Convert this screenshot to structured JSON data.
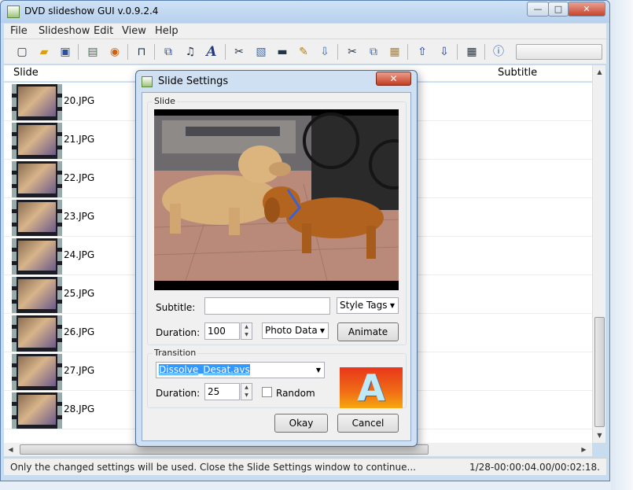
{
  "window": {
    "title": "DVD slideshow GUI v.0.9.2.4",
    "minimize": "—",
    "maximize": "□",
    "close": "✕"
  },
  "menu": [
    "File",
    "Slideshow",
    "Edit",
    "View",
    "Help"
  ],
  "toolbar_icons": [
    "new-icon",
    "open-icon",
    "save-icon",
    "add-slides-icon",
    "add-dvd-icon",
    "preview-icon",
    "copy-slide-icon",
    "music-icon",
    "title-icon",
    "cut-icon",
    "image-edit-icon",
    "clapper-icon",
    "pencil-icon",
    "burn-icon",
    "scissors-icon",
    "copy-icon",
    "paste-icon",
    "move-up-icon",
    "move-down-icon",
    "grid-icon",
    "help-icon"
  ],
  "list": {
    "headers": {
      "slide": "Slide",
      "subtitle": "Subtitle"
    },
    "rows": [
      "20.JPG",
      "21.JPG",
      "22.JPG",
      "23.JPG",
      "24.JPG",
      "25.JPG",
      "26.JPG",
      "27.JPG",
      "28.JPG"
    ]
  },
  "status": {
    "text": "Only the changed settings will be used. Close the Slide Settings window to continue...",
    "time": "1/28-00:00:04.00/00:02:18."
  },
  "dialog": {
    "title": "Slide Settings",
    "close": "✕",
    "slide_group": "Slide",
    "subtitle_label": "Subtitle:",
    "subtitle_value": "",
    "style_tags": "Style Tags",
    "duration_label": "Duration:",
    "duration_value": "100",
    "photo_data": "Photo Data",
    "animate": "Animate",
    "transition_group": "Transition",
    "transition_value": "Dissolve_Desat.avs",
    "trans_duration_label": "Duration:",
    "trans_duration_value": "25",
    "random_label": "Random",
    "preview_letter": "A",
    "okay": "Okay",
    "cancel": "Cancel"
  }
}
